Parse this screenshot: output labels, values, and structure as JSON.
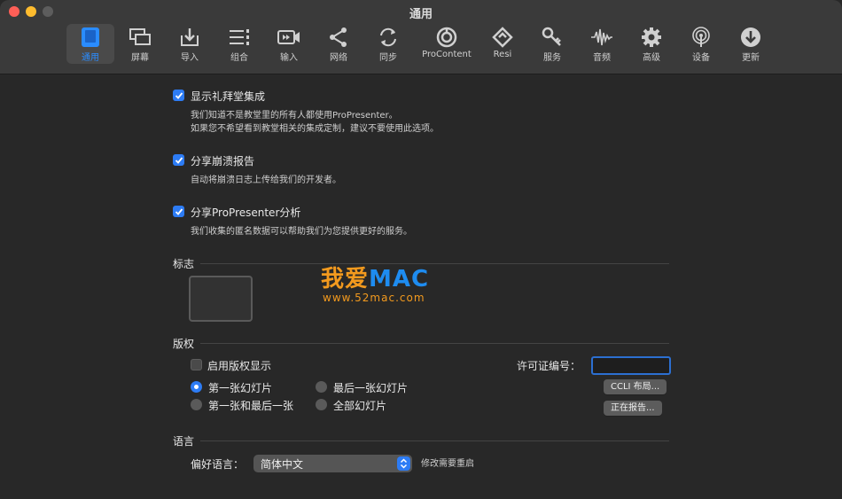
{
  "window": {
    "title": "通用"
  },
  "toolbar": {
    "items": [
      {
        "label": "通用",
        "icon": "general-icon"
      },
      {
        "label": "屏幕",
        "icon": "screens-icon"
      },
      {
        "label": "导入",
        "icon": "import-icon"
      },
      {
        "label": "组合",
        "icon": "groups-icon"
      },
      {
        "label": "输入",
        "icon": "inputs-icon"
      },
      {
        "label": "网络",
        "icon": "network-icon"
      },
      {
        "label": "同步",
        "icon": "sync-icon"
      },
      {
        "label": "ProContent",
        "icon": "procontent-icon"
      },
      {
        "label": "Resi",
        "icon": "resi-icon"
      },
      {
        "label": "服务",
        "icon": "services-icon"
      },
      {
        "label": "音频",
        "icon": "audio-icon"
      },
      {
        "label": "高级",
        "icon": "advanced-gear-icon"
      },
      {
        "label": "设备",
        "icon": "devices-icon"
      },
      {
        "label": "更新",
        "icon": "updates-icon"
      }
    ]
  },
  "general": {
    "show_chapel": {
      "label": "显示礼拜堂集成",
      "checked": true,
      "desc1": "我们知道不是教堂里的所有人都使用ProPresenter。",
      "desc2": "如果您不希望看到教堂相关的集成定制，建议不要使用此选项。"
    },
    "share_crash": {
      "label": "分享崩溃报告",
      "checked": true,
      "desc1": "自动将崩溃日志上传给我们的开发者。"
    },
    "share_analytics": {
      "label": "分享ProPresenter分析",
      "checked": true,
      "desc1": "我们收集的匿名数据可以帮助我们为您提供更好的服务。"
    }
  },
  "logo": {
    "section": "标志"
  },
  "copyright": {
    "section": "版权",
    "enable_label": "启用版权显示",
    "enabled": false,
    "license_label": "许可证编号：",
    "license_value": "",
    "radios": [
      {
        "label": "第一张幻灯片",
        "selected": true
      },
      {
        "label": "最后一张幻灯片",
        "selected": false
      },
      {
        "label": "第一张和最后一张",
        "selected": false
      },
      {
        "label": "全部幻灯片",
        "selected": false
      }
    ],
    "ccli_button": "CCLI 布局...",
    "report_button": "正在报告..."
  },
  "language": {
    "section": "语言",
    "pref_label": "偏好语言：",
    "selected": "简体中文",
    "note": "修改需要重启"
  },
  "watermark": {
    "main_cn": "我爱",
    "main_en": "MAC",
    "sub": "www.52mac.com"
  },
  "colors": {
    "accent": "#2d7cf5",
    "watermark_orange": "#f39a1e",
    "watermark_blue": "#1e8cf0"
  }
}
